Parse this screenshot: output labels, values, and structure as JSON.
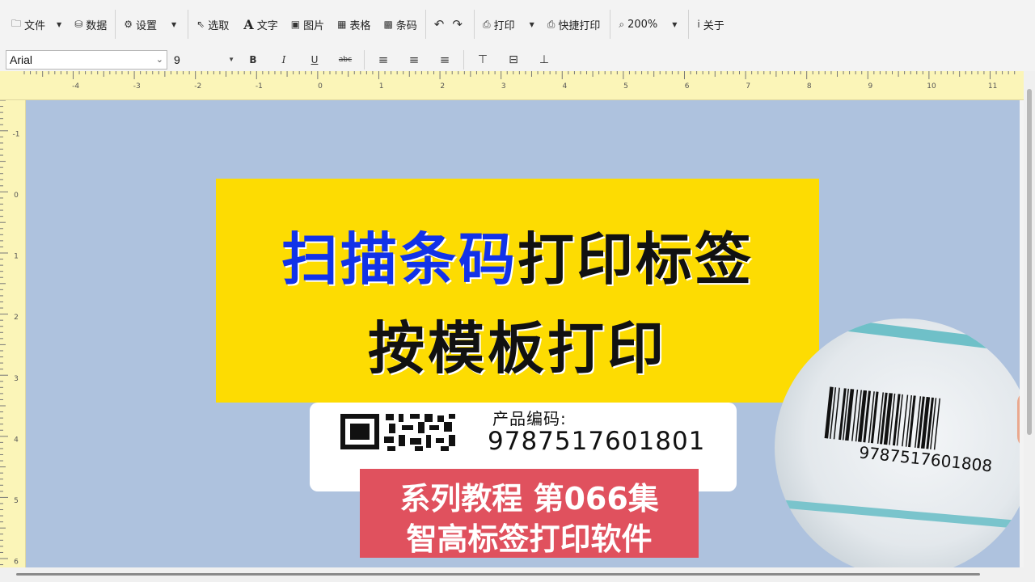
{
  "toolbar": {
    "file": "文件",
    "data": "数据",
    "settings": "设置",
    "select": "选取",
    "text": "文字",
    "image": "图片",
    "table": "表格",
    "barcode": "条码",
    "print": "打印",
    "quick_print": "快捷打印",
    "zoom": "200%",
    "about": "关于"
  },
  "format_bar": {
    "font": "Arial",
    "size": "9",
    "bold": "B",
    "italic": "I",
    "underline": "U",
    "strike": "abc"
  },
  "ruler": {
    "horizontal": [
      "-4",
      "-3",
      "-2",
      "-1",
      "0",
      "1",
      "2",
      "3",
      "4",
      "5",
      "6",
      "7",
      "8",
      "9",
      "10",
      "11"
    ],
    "vertical": [
      "-1",
      "0",
      "1",
      "2",
      "3",
      "4",
      "5",
      "6"
    ]
  },
  "label": {
    "title": "产品编码:",
    "code": "9787517601801"
  },
  "banner": {
    "highlight": "扫描条码",
    "rest": "打印标签",
    "line2": "按模板打印"
  },
  "series": {
    "line1": "系列教程 第066集",
    "line2": "智高标签打印软件"
  },
  "roll": {
    "barcode_number": "9787517601808"
  },
  "colors": {
    "canvas": "#aec2de",
    "banner": "#fddc02",
    "highlight": "#1232e8",
    "series": "#e0515e",
    "ruler": "#fbf5b8"
  }
}
